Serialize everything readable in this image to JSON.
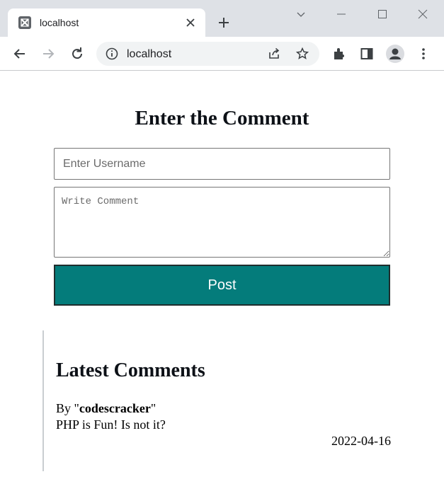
{
  "browser": {
    "tab_title": "localhost",
    "url": "localhost",
    "icons": [
      "xampp-favicon",
      "tab-close-icon",
      "new-tab-icon",
      "tab-search-icon",
      "minimize-icon",
      "maximize-icon",
      "close-window-icon",
      "back-icon",
      "forward-icon",
      "reload-icon",
      "info-icon",
      "share-icon",
      "bookmark-star-icon",
      "extensions-icon",
      "side-panel-icon",
      "profile-icon",
      "menu-icon"
    ]
  },
  "form": {
    "title": "Enter the Comment",
    "username_placeholder": "Enter Username",
    "comment_placeholder": "Write Comment",
    "post_label": "Post"
  },
  "latest": {
    "title": "Latest Comments",
    "comments": [
      {
        "by_prefix": "By \"",
        "author": "codescracker",
        "by_suffix": "\"",
        "text": "PHP is Fun! Is not it?",
        "date": "2022-04-16"
      }
    ]
  }
}
